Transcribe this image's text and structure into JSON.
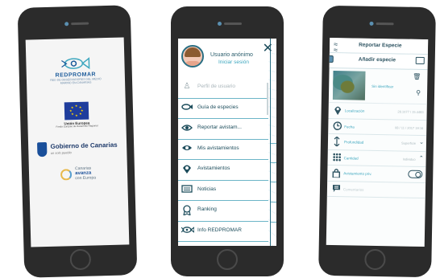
{
  "splash": {
    "brand": "REDPROMAR",
    "brand_sub": "RED DE OBSERVADORES DEL MEDIO MARINO EN CANARIAS",
    "eu_title": "Unión Europea",
    "eu_fund": "Fondo Europeo de Desarrollo Regional",
    "gob_title": "Gobierno de Canarias",
    "gob_slogan": "un solo pueblo",
    "can_line1": "Canarias",
    "can_line2": "avanza",
    "can_line3": "con Europa"
  },
  "menu": {
    "user_name": "Usuario anónimo",
    "login_link": "Iniciar sesión",
    "close_icon": "close-icon",
    "items": [
      {
        "label": "Perfil de usuario",
        "icon": "user-icon",
        "enabled": false
      },
      {
        "label": "Guía de especies",
        "icon": "fish-icon",
        "enabled": true
      },
      {
        "label": "Reportar avistam...",
        "icon": "eye-wave-icon",
        "enabled": true
      },
      {
        "label": "Mis avistamientos",
        "icon": "eye-icon",
        "enabled": true
      },
      {
        "label": "Avistamientos",
        "icon": "map-pin-eye-icon",
        "enabled": true
      },
      {
        "label": "Noticias",
        "icon": "newspaper-icon",
        "enabled": true
      },
      {
        "label": "Ranking",
        "icon": "medal-icon",
        "enabled": true
      },
      {
        "label": "Info REDPROMAR",
        "icon": "fish-logo-icon",
        "enabled": true
      }
    ]
  },
  "report": {
    "title": "Reportar Especie",
    "add_species": "Añadir especie",
    "species_label": "Sin identificar",
    "fields": [
      {
        "label": "Localización",
        "value": "28.1077 / 15.4483",
        "icon": "location-pin-icon"
      },
      {
        "label": "Fecha",
        "value": "08 / 11 / 2017 19:16",
        "icon": "clock-icon"
      },
      {
        "label": "Profundidad",
        "value": "Superficie",
        "icon": "depth-icon",
        "control": "chevron-down"
      },
      {
        "label": "Cantidad",
        "value": "Individuo",
        "icon": "grid-dots-icon",
        "control": "chevron-up"
      },
      {
        "label": "Avistamiento priv.",
        "value": "",
        "icon": "lock-icon",
        "control": "toggle",
        "toggle_on": true
      },
      {
        "label": "Comentarios",
        "value": "",
        "icon": "comment-icon"
      }
    ]
  },
  "colors": {
    "accent": "#3ea7bf",
    "dark": "#2d5361",
    "phone": "#2b2b2b"
  }
}
